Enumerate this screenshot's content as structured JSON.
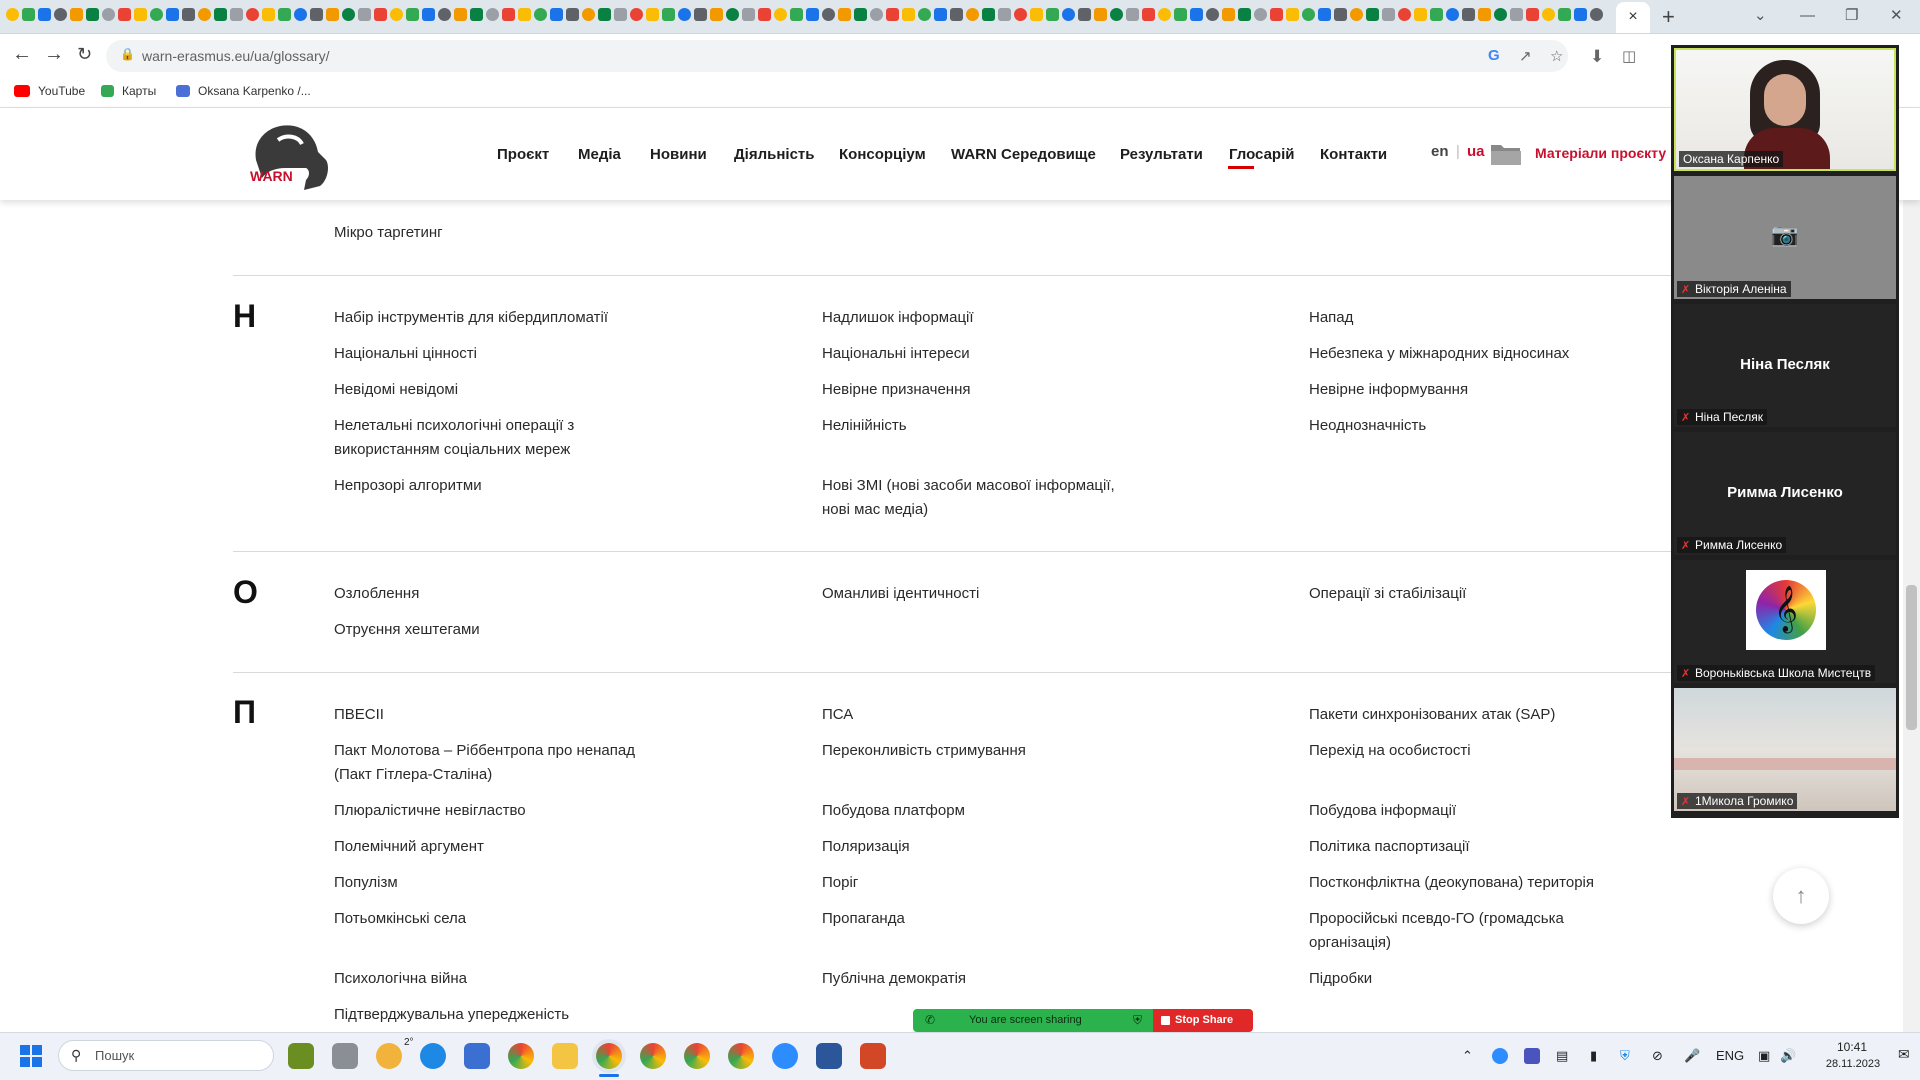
{
  "browser": {
    "active_tab_close": "×",
    "new_tab": "+",
    "url": "warn-erasmus.eu/ua/glossary/",
    "bookmarks": [
      {
        "label": "YouTube",
        "color": "#ff0000"
      },
      {
        "label": "Карты",
        "color": "#34a853"
      },
      {
        "label": "Oksana Karpenko /...",
        "color": "#4a6fd6"
      }
    ],
    "window_controls": [
      "⌄",
      "—",
      "❐",
      "✕"
    ]
  },
  "site": {
    "logo_text": "WARN",
    "nav": [
      "Проєкт",
      "Медіа",
      "Новини",
      "Діяльність",
      "Консорціум",
      "WARN Середовище",
      "Результати",
      "Глосарій",
      "Контакти"
    ],
    "active_nav": "Глосарій",
    "lang_en": "en",
    "lang_sep": "|",
    "lang_ua": "ua",
    "materials": "Матеріали проєкту",
    "accent": "#c8102e"
  },
  "glossary": {
    "m_partial": {
      "col1": [
        "Мікро таргетинг"
      ]
    },
    "sections": [
      {
        "letter": "Н",
        "col1": [
          "Набір інструментів для кібердипломатії",
          "Національні цінності",
          "Невідомі невідомі",
          "Нелетальні психологічні операції з використанням соціальних мереж",
          "Непрозорі алгоритми"
        ],
        "col2": [
          "Надлишок інформації",
          "Національні інтереси",
          "Невірне призначення",
          "Нелінійність",
          "Нові ЗМІ (нові засоби масової інформації, нові мас медіа)"
        ],
        "col3": [
          "Напад",
          "Небезпека у міжнародних відносинах",
          "Невірне інформування",
          "Неоднозначність"
        ]
      },
      {
        "letter": "О",
        "col1": [
          "Озлоблення",
          "Отруєння хештегами"
        ],
        "col2": [
          "Оманливі ідентичності"
        ],
        "col3": [
          "Операції зі стабілізації"
        ]
      },
      {
        "letter": "П",
        "col1": [
          "ПВЕСІІ",
          "Пакт Молотова – Ріббентропа про ненапад (Пакт Гітлера-Сталіна)",
          "Плюралістичне невігластво",
          "Полемічний аргумент",
          "Популізм",
          "Потьомкінські села",
          "Психологічна війна",
          "Підтверджувальна упередженість"
        ],
        "col2": [
          "ПСА",
          "Переконливість стримування",
          "Побудова платформ",
          "Поляризація",
          "Поріг",
          "Пропаганда",
          "Публічна демократія"
        ],
        "col3": [
          "Пакети синхронізованих атак (SAP)",
          "Перехід на особистості",
          "Побудова інформації",
          "Політика паспортизації",
          "Постконфліктна (деокупована) територія",
          "Проросійські псевдо-ГО (громадська організація)",
          "Підробки"
        ]
      }
    ]
  },
  "zoom": {
    "participants": [
      {
        "name": "Оксана Карпенко",
        "type": "video"
      },
      {
        "name": "Вікторія Аленіна",
        "type": "camera-off"
      },
      {
        "name": "Ніна Песляк",
        "type": "name",
        "center": "Ніна Песляк"
      },
      {
        "name": "Римма Лисенко",
        "type": "name",
        "center": "Римма Лисенко"
      },
      {
        "name": "Вороньківська Школа Мистецтв",
        "type": "logo"
      },
      {
        "name": "1Микола Громико",
        "type": "video"
      }
    ],
    "sharing_text": "You are screen sharing",
    "stop_share": "Stop Share"
  },
  "taskbar": {
    "search_placeholder": "Пошук",
    "weather": "2°",
    "lang": "ENG",
    "time": "10:41",
    "date": "28.11.2023"
  }
}
